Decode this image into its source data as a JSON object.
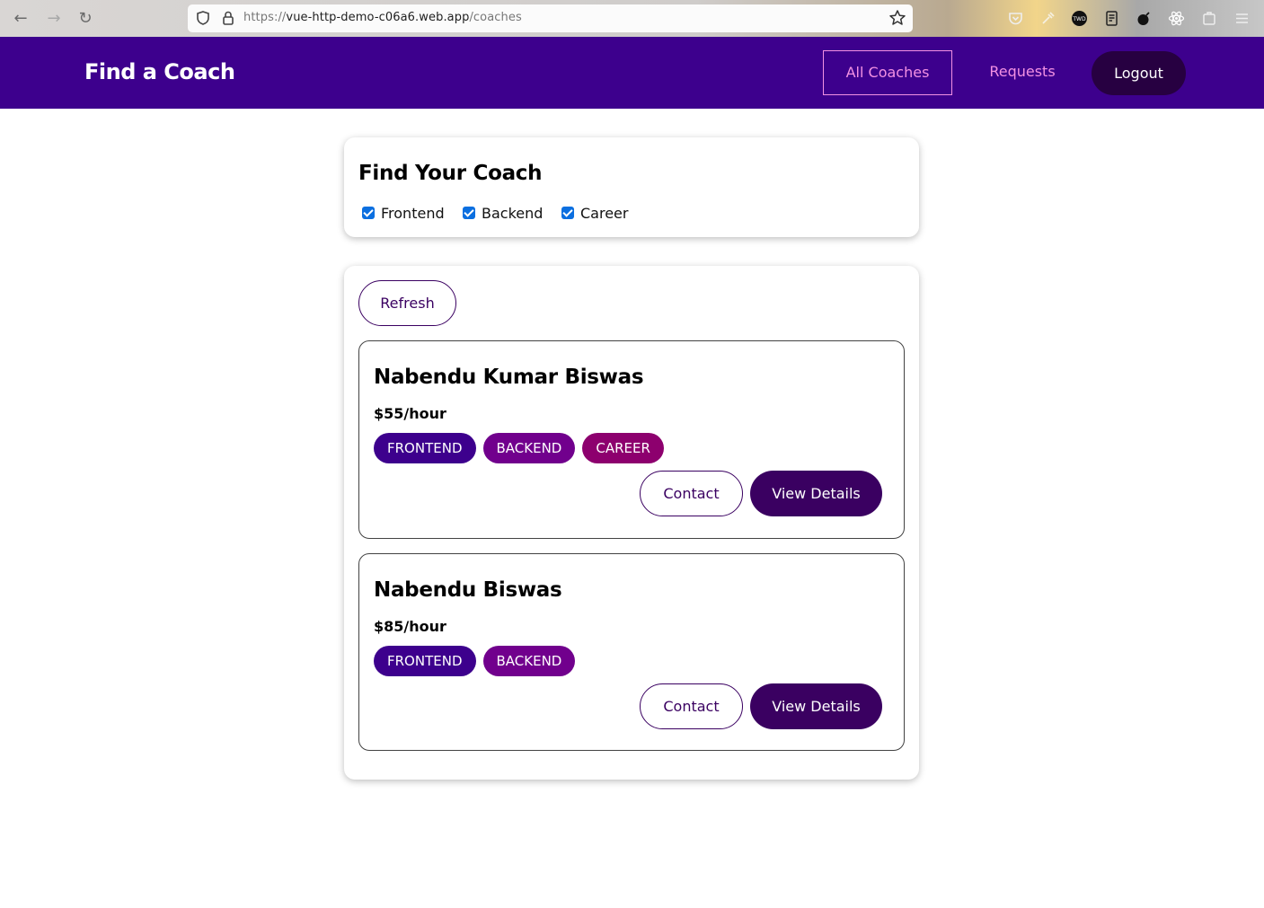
{
  "browser": {
    "url_scheme": "https://",
    "url_host": "vue-http-demo-c06a6.web.app",
    "url_path": "/coaches"
  },
  "header": {
    "brand": "Find a Coach",
    "nav": {
      "all_coaches": "All Coaches",
      "requests": "Requests",
      "logout": "Logout"
    },
    "colors": {
      "background": "#3d008d",
      "link": "#f391e3",
      "logout_bg": "#270041"
    }
  },
  "filter": {
    "title": "Find Your Coach",
    "options": [
      {
        "label": "Frontend",
        "checked": true
      },
      {
        "label": "Backend",
        "checked": true
      },
      {
        "label": "Career",
        "checked": true
      }
    ]
  },
  "list": {
    "refresh_label": "Refresh",
    "coaches": [
      {
        "name": "Nabendu Kumar Biswas",
        "rate": "$55/hour",
        "areas": [
          "FRONTEND",
          "BACKEND",
          "CAREER"
        ],
        "contact_label": "Contact",
        "details_label": "View Details"
      },
      {
        "name": "Nabendu Biswas",
        "rate": "$85/hour",
        "areas": [
          "FRONTEND",
          "BACKEND"
        ],
        "contact_label": "Contact",
        "details_label": "View Details"
      }
    ]
  },
  "badge_colors": {
    "frontend": "#3d008d",
    "backend": "#71008d",
    "career": "#8d006e"
  }
}
